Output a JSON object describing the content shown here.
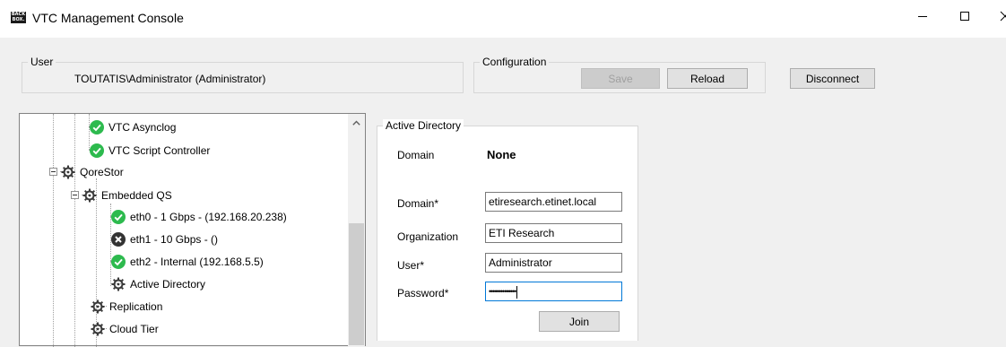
{
  "window": {
    "title": "VTC Management Console",
    "logo_text": "BACK BOX."
  },
  "user_group": {
    "legend": "User",
    "value": "TOUTATIS\\Administrator (Administrator)"
  },
  "config_group": {
    "legend": "Configuration",
    "save_label": "Save",
    "reload_label": "Reload"
  },
  "disconnect_label": "Disconnect",
  "tree": {
    "items": [
      {
        "label": "VTC Asynclog",
        "icon": "check-circle-icon",
        "status": "ok"
      },
      {
        "label": "VTC Script Controller",
        "icon": "check-circle-icon",
        "status": "ok"
      },
      {
        "label": "QoreStor",
        "icon": "gear-icon",
        "expanded": true
      },
      {
        "label": "Embedded QS",
        "icon": "gear-icon",
        "expanded": true
      },
      {
        "label": "eth0 - 1 Gbps - (192.168.20.238)",
        "icon": "check-circle-icon",
        "status": "ok"
      },
      {
        "label": "eth1 - 10 Gbps - ()",
        "icon": "error-circle-icon",
        "status": "error"
      },
      {
        "label": "eth2 - Internal (192.168.5.5)",
        "icon": "check-circle-icon",
        "status": "ok"
      },
      {
        "label": "Active Directory",
        "icon": "gear-icon"
      },
      {
        "label": "Replication",
        "icon": "gear-icon"
      },
      {
        "label": "Cloud Tier",
        "icon": "gear-icon"
      }
    ]
  },
  "active_directory": {
    "legend": "Active Directory",
    "domain_label": "Domain",
    "domain_value": "None",
    "domain_field_label": "Domain*",
    "domain_field_value": "etiresearch.etinet.local",
    "org_label": "Organization",
    "org_value": "ETI Research",
    "user_label": "User*",
    "user_value": "Administrator",
    "password_label": "Password*",
    "password_value": "••••••••••••••",
    "join_label": "Join"
  },
  "colors": {
    "ok": "#2dba4e",
    "error": "#333333",
    "focus": "#0078d7"
  }
}
